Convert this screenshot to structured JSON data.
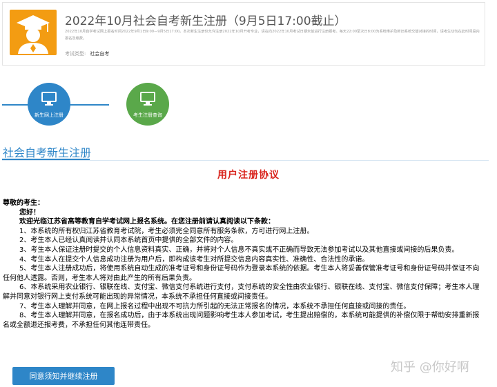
{
  "header": {
    "title": "2022年10月社会自考新生注册（9月5日17:00截止）",
    "notice": "2022年10月自学考试网上报名时间2022年9月1日9:00—9月5日17:00。本次新生注册仅允许注册2022年10月开考专业，请在向2022年10月考试日期未前进行注册报考。每天22:00至次日8:00为系统维护及新旧系统交替对接的时间，请考生切勿在此时间段内报名及缴费。",
    "exam_type_label": "考试类型:",
    "exam_type_value": "社会自考"
  },
  "steps": [
    {
      "label": "新生网上注册",
      "icon": "monitor-icon"
    },
    {
      "label": "考生注册查询",
      "icon": "monitor-icon"
    }
  ],
  "section_title": "社会自考新生注册",
  "agreement": {
    "title": "用户注册协议",
    "greeting": "尊敬的考生：",
    "hello": "您好！",
    "welcome": "欢迎光临江苏省高等教育自学考试网上报名系统。在您注册前请认真阅读以下条款：",
    "clauses": [
      "1、本系统的所有权归江苏省教育考试院，考生必须完全同意所有服务条款，方可进行网上注册。",
      "2、考生本人已经认真阅读并认同本系统首页中提供的全部文件的内容。",
      "3、考生本人保证注册时提交的个人信息资料真实、正确，并将对个人信息不真实或不正确而导致无法参加考试以及其他直接或间接的后果负责。",
      "4、考生本人在提交个人信息成功注册为用户后，即构成该考生对所提交信息内容真实性、准确性、合法性的承诺。",
      "5、考生本人注册成功后，将使用系统自动生成的准考证号和身份证号码作为登录本系统的依据。考生本人将妥善保管准考证号和身份证号码并保证不向任何他人透露。否则，考生本人将对由此产生的所有后果负责。",
      "6、本系统采用农业银行、银联在线、支付宝、微信支付系统进行支付，支付系统的安全性由农业银行、银联在线、支付宝、微信支付保障；考生本人理解并同意对银行网上支付系统可能出现的异常情况，本系统不承担任何直接或间接责任。",
      "7、考生本人理解并同意，在网上报名过程中出现不可抗力所引起的无法正常报名的情况，本系统不承担任何直接或间接的责任。",
      "8、考生本人理解并同意，在报名成功后，由于本系统出现问题影响考生本人参加考试，考生提出赔偿的，本系统可能提供的补偿仅限于帮助安排重新报名或全额退还报考费，不承担任何其他连带责任。"
    ]
  },
  "agree_button": "同意须知并继续注册",
  "watermark": "知乎 @你好啊",
  "colors": {
    "accent_blue": "#2e86c8",
    "step_green": "#5aa84a",
    "logo_orange": "#f39c12",
    "title_red": "#d9241d"
  }
}
